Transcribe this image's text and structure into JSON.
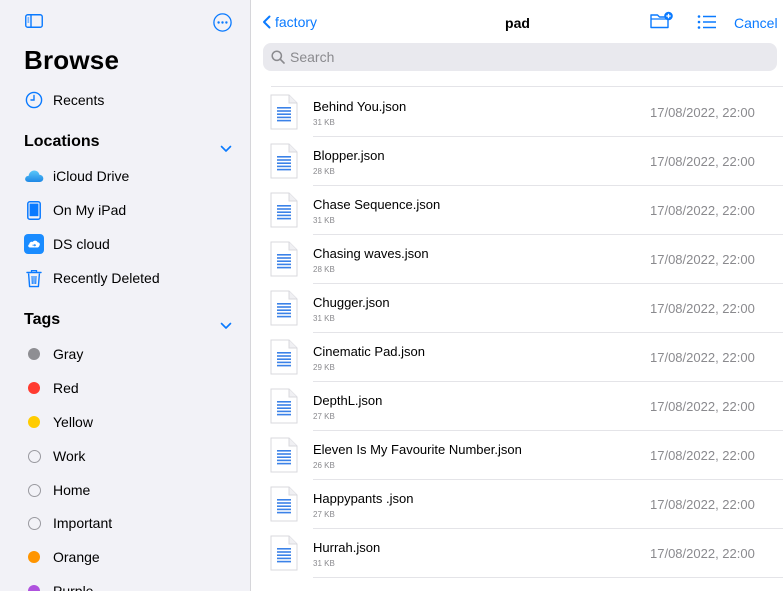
{
  "sidebar": {
    "title": "Browse",
    "recents_label": "Recents",
    "locations": {
      "header": "Locations",
      "items": [
        {
          "label": "iCloud Drive",
          "icon": "icloud-icon"
        },
        {
          "label": "On My iPad",
          "icon": "ipad-icon"
        },
        {
          "label": "DS cloud",
          "icon": "ds-cloud-icon"
        },
        {
          "label": "Recently Deleted",
          "icon": "trash-icon"
        }
      ]
    },
    "tags": {
      "header": "Tags",
      "items": [
        {
          "label": "Gray",
          "color": "#8e8e93"
        },
        {
          "label": "Red",
          "color": "#ff3b30"
        },
        {
          "label": "Yellow",
          "color": "#ffcc00"
        },
        {
          "label": "Work",
          "color": ""
        },
        {
          "label": "Home",
          "color": ""
        },
        {
          "label": "Important",
          "color": ""
        },
        {
          "label": "Orange",
          "color": "#ff9500"
        },
        {
          "label": "Purple",
          "color": "#af52de"
        }
      ]
    }
  },
  "nav": {
    "back_label": "factory",
    "title": "pad",
    "cancel_label": "Cancel"
  },
  "search": {
    "placeholder": "Search"
  },
  "files": [
    {
      "name": "Behind You.json",
      "size": "31 KB",
      "date": "17/08/2022, 22:00"
    },
    {
      "name": "Blopper.json",
      "size": "28 KB",
      "date": "17/08/2022, 22:00"
    },
    {
      "name": "Chase Sequence.json",
      "size": "31 KB",
      "date": "17/08/2022, 22:00"
    },
    {
      "name": "Chasing waves.json",
      "size": "28 KB",
      "date": "17/08/2022, 22:00"
    },
    {
      "name": "Chugger.json",
      "size": "31 KB",
      "date": "17/08/2022, 22:00"
    },
    {
      "name": "Cinematic Pad.json",
      "size": "29 KB",
      "date": "17/08/2022, 22:00"
    },
    {
      "name": "DepthL.json",
      "size": "27 KB",
      "date": "17/08/2022, 22:00"
    },
    {
      "name": "Eleven Is My Favourite Number.json",
      "size": "26 KB",
      "date": "17/08/2022, 22:00"
    },
    {
      "name": "Happypants .json",
      "size": "27 KB",
      "date": "17/08/2022, 22:00"
    },
    {
      "name": "Hurrah.json",
      "size": "31 KB",
      "date": "17/08/2022, 22:00"
    }
  ],
  "colors": {
    "accent": "#0a7aff",
    "sidebar_bg": "#f2f2f7",
    "secondary_text": "#8a8a8e"
  }
}
